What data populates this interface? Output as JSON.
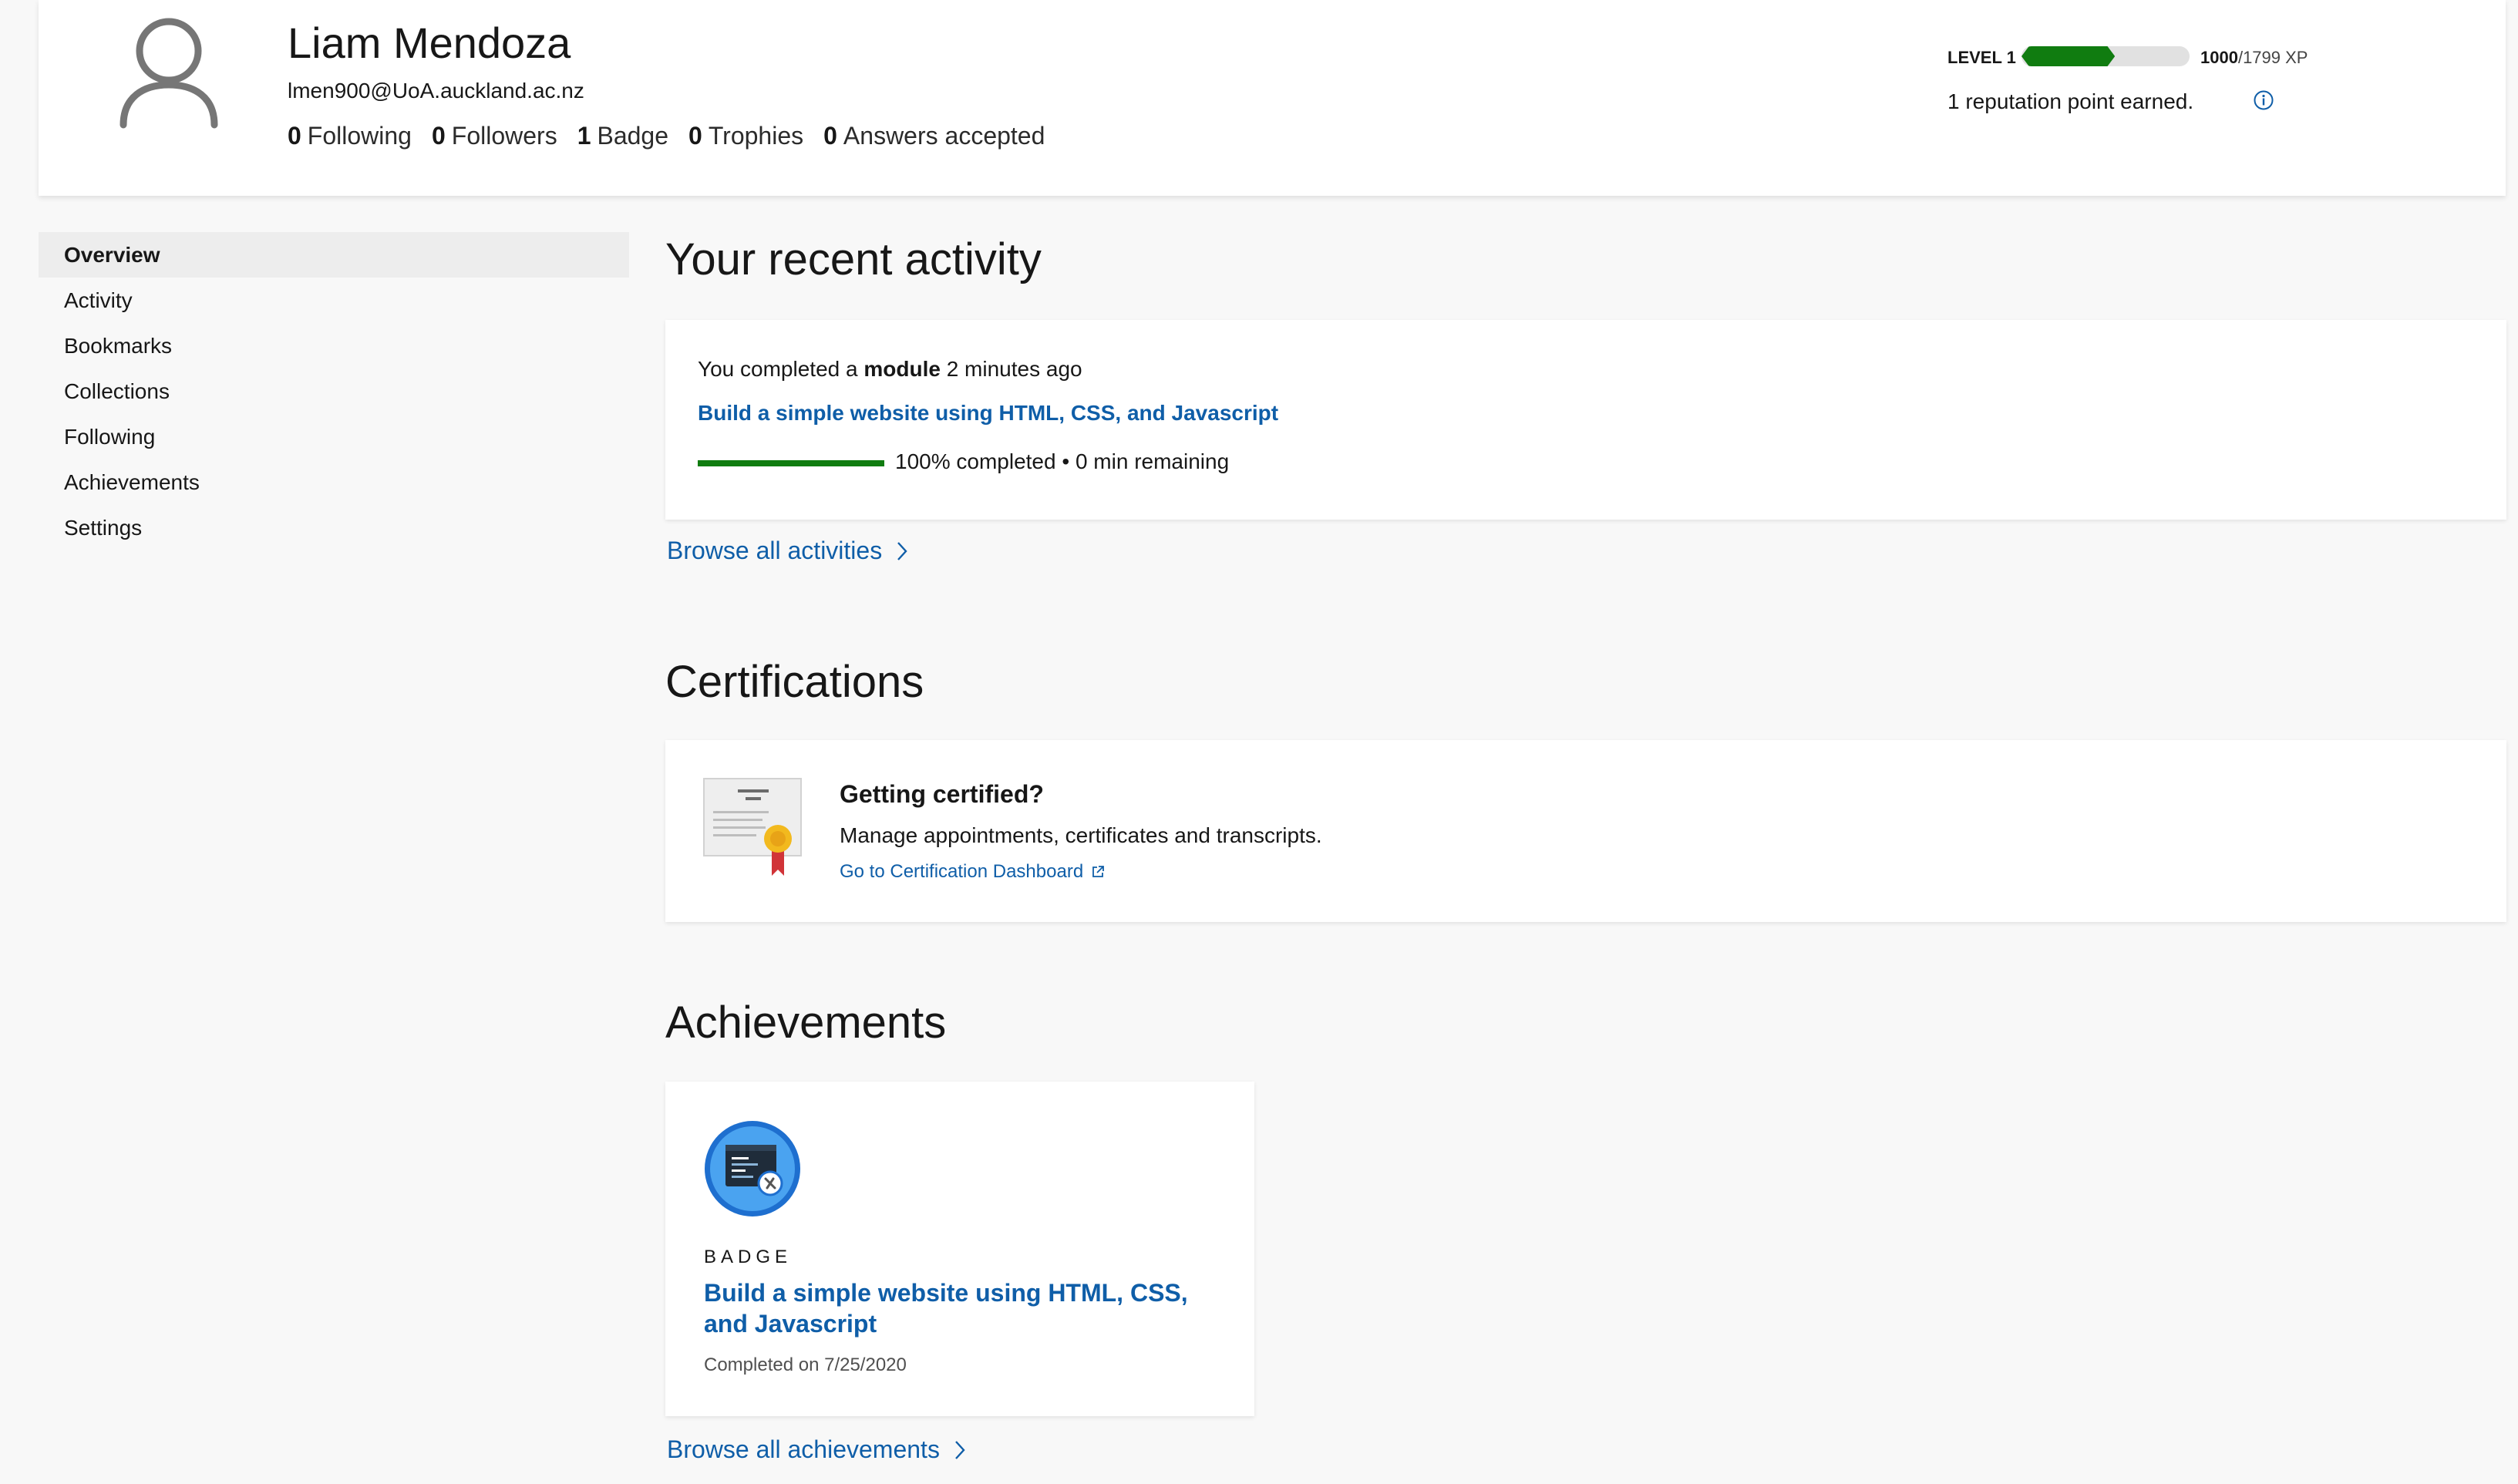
{
  "profile": {
    "name": "Liam Mendoza",
    "email": "lmen900@UoA.auckland.ac.nz",
    "stats": [
      {
        "value": "0",
        "label": "Following"
      },
      {
        "value": "0",
        "label": "Followers"
      },
      {
        "value": "1",
        "label": "Badge"
      },
      {
        "value": "0",
        "label": "Trophies"
      },
      {
        "value": "0",
        "label": "Answers accepted"
      }
    ],
    "level_label": "LEVEL 1",
    "xp_current": "1000",
    "xp_max": "/1799 XP",
    "xp_fraction": 0.556,
    "reputation_text": "1 reputation point earned."
  },
  "sidebar": {
    "items": [
      {
        "label": "Overview",
        "active": true
      },
      {
        "label": "Activity",
        "active": false
      },
      {
        "label": "Bookmarks",
        "active": false
      },
      {
        "label": "Collections",
        "active": false
      },
      {
        "label": "Following",
        "active": false
      },
      {
        "label": "Achievements",
        "active": false
      },
      {
        "label": "Settings",
        "active": false
      }
    ]
  },
  "recent_activity": {
    "title": "Your recent activity",
    "prefix": "You completed a ",
    "item_type": "module",
    "time": " 2 minutes ago",
    "module_title": "Build a simple website using HTML, CSS, and Javascript",
    "progress_percent": 100,
    "progress_text": "100% completed • 0 min remaining",
    "browse_label": "Browse all activities"
  },
  "certifications": {
    "title": "Certifications",
    "card_title": "Getting certified?",
    "card_desc": "Manage appointments, certificates and transcripts.",
    "link_label": "Go to Certification Dashboard"
  },
  "achievements": {
    "title": "Achievements",
    "badge_kind": "BADGE",
    "badge_title": "Build a simple website using HTML, CSS, and Javascript",
    "badge_date": "Completed on 7/25/2020",
    "browse_label": "Browse all achievements"
  },
  "colors": {
    "accent": "#0f5ea8",
    "progress": "#107c10",
    "background": "#f8f8f8"
  },
  "icons": {
    "avatar": "person-outline-icon",
    "info": "info-circle-icon",
    "chevron": "chevron-right-icon",
    "external": "external-link-icon",
    "certificate": "certificate-icon",
    "badge": "code-editor-badge-icon"
  }
}
